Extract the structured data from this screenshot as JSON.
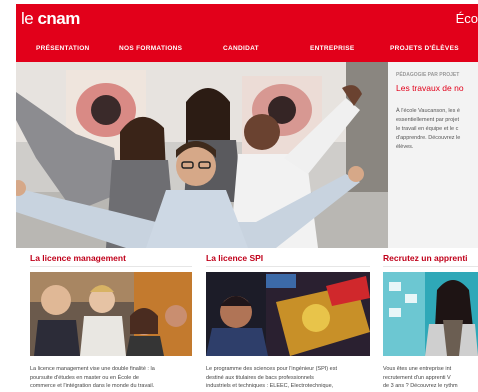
{
  "header": {
    "logo_light": "le ",
    "logo_bold": "cnam",
    "site_title": "Éco"
  },
  "nav": {
    "items": [
      "PRÉSENTATION",
      "NOS FORMATIONS",
      "CANDIDAT",
      "ENTREPRISE",
      "PROJETS D'ÉLÈVES"
    ]
  },
  "side_panel": {
    "kicker": "PÉDAGOGIE PAR PROJET",
    "title": "Les travaux de no",
    "lines": [
      "À l'école Vaucanson, les é",
      "essentiellement par projet",
      "le travail en équipe et le c",
      "d'apprendre. Découvrez le",
      "élèves."
    ]
  },
  "cards": [
    {
      "title": "La licence management",
      "lines": [
        "La licence management vise une double finalité : la",
        "poursuite d'études en master ou en École de",
        "commerce et l'intégration dans le monde du travail."
      ]
    },
    {
      "title": "La licence SPI",
      "lines": [
        "Le programme des sciences pour l'ingénieur (SPI) est",
        "destiné aux titulaires de bacs professionnels",
        "industriels et techniques : ELEEC, Electrotechnique,"
      ]
    },
    {
      "title": "Recrutez un apprenti",
      "lines": [
        "Vous êtes une entreprise int",
        "recrutement d'un apprenti V",
        "de 3 ans ? Découvrez le rythm"
      ]
    }
  ],
  "colors": {
    "brand_red": "#e2001a",
    "title_red": "#c0001a",
    "panel_grey": "#f3f3f3"
  }
}
